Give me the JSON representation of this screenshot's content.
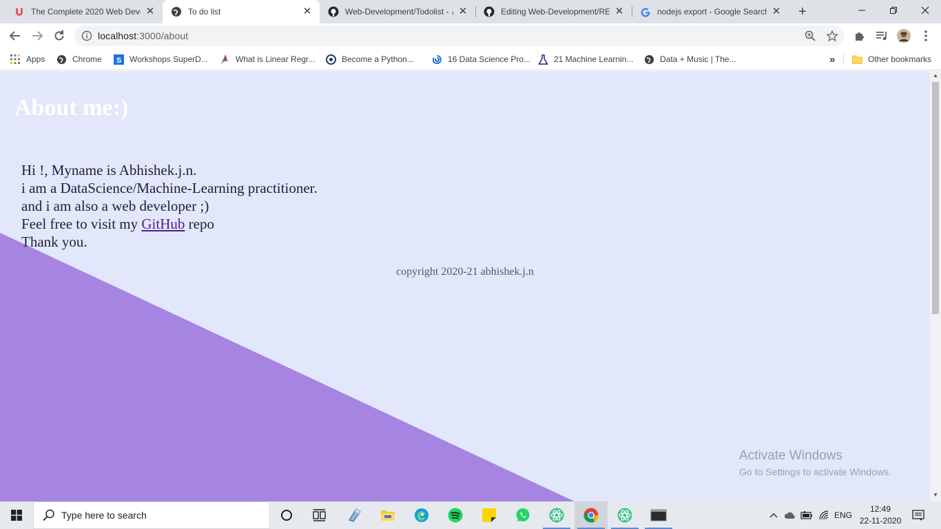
{
  "browser": {
    "tabs": [
      {
        "title": "The Complete 2020 Web Deve",
        "favicon": "udemy-icon"
      },
      {
        "title": "To do list",
        "favicon": "globe-icon"
      },
      {
        "title": "Web-Development/Todolist - ∧",
        "favicon": "github-icon"
      },
      {
        "title": "Editing Web-Development/REA",
        "favicon": "github-icon"
      },
      {
        "title": "nodejs export - Google Search",
        "favicon": "google-icon"
      }
    ],
    "new_tab_label": "+",
    "url_host": "localhost",
    "url_path": ":3000/about",
    "bookmarks": [
      {
        "label": "Apps"
      },
      {
        "label": "Chrome"
      },
      {
        "label": "Workshops SuperD..."
      },
      {
        "label": "What is Linear Regr..."
      },
      {
        "label": "Become a Python..."
      },
      {
        "label": "16 Data Science Pro..."
      },
      {
        "label": "21 Machine Learnin..."
      },
      {
        "label": "Data + Music | The..."
      }
    ],
    "bookmarks_overflow": "»",
    "other_bookmarks": "Other bookmarks"
  },
  "page": {
    "title": "About me:)",
    "lines": [
      "Hi !, Myname is Abhishek.j.n.",
      "i am a DataScience/Machine-Learning practitioner.",
      "and i am also a web developer ;)"
    ],
    "visit_prefix": "Feel free to visit my",
    "github_link": "GitHub",
    "visit_suffix": "repo",
    "thanks": "Thank you.",
    "copyright": "copyright 2020-21 abhishek.j.n",
    "colors": {
      "background": "#e2e7fb",
      "triangle": "#a684e2",
      "link": "#551a8b"
    }
  },
  "watermark": {
    "line1": "Activate Windows",
    "line2": "Go to Settings to activate Windows."
  },
  "taskbar": {
    "search_placeholder": "Type here to search",
    "language": "ENG",
    "time": "12:49",
    "date": "22-11-2020"
  }
}
